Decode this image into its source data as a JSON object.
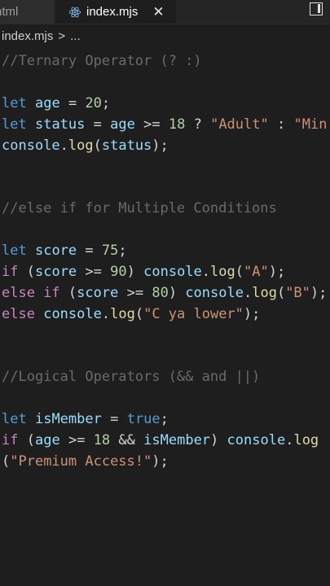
{
  "tabs": {
    "inactive_label": "html",
    "active_label": "index.mjs",
    "close_glyph": "✕"
  },
  "breadcrumb": {
    "file": "index.mjs",
    "separator": ">",
    "more": "..."
  },
  "code": {
    "c1": "//Ternary Operator (? :)",
    "l2_kw": "let",
    "l2_var": "age",
    "l2_op": "=",
    "l2_num": "20",
    "l2_end": ";",
    "l3_kw": "let",
    "l3_var": "status",
    "l3_op": "=",
    "l3_var2": "age",
    "l3_cmp": ">=",
    "l3_num": "18",
    "l3_q": "?",
    "l3_str": "\"Adult\"",
    "l3_colon": ":",
    "l3_str2": "\"Min",
    "l4_obj": "console",
    "l4_dot": ".",
    "l4_fn": "log",
    "l4_open": "(",
    "l4_arg": "status",
    "l4_close": ");",
    "c2": "//else if for Multiple Conditions",
    "l6_kw": "let",
    "l6_var": "score",
    "l6_op": "=",
    "l6_num": "75",
    "l6_end": ";",
    "l7_kw": "if",
    "l7_open": "(",
    "l7_var": "score",
    "l7_cmp": ">=",
    "l7_num": "90",
    "l7_close": ")",
    "l7_obj": "console",
    "l7_dot": ".",
    "l7_fn": "log",
    "l7_p1": "(",
    "l7_str": "\"A\"",
    "l7_p2": ");",
    "l8_kw": "else if",
    "l8_open": "(",
    "l8_var": "score",
    "l8_cmp": ">=",
    "l8_num": "80",
    "l8_close": ")",
    "l8_obj": "console",
    "l8_dot": ".",
    "l8_fn": "log",
    "l8_p1": "(",
    "l8_str": "\"B\"",
    "l8_p2": ");",
    "l9_kw": "else",
    "l9_obj": "console",
    "l9_dot": ".",
    "l9_fn": "log",
    "l9_p1": "(",
    "l9_str": "\"C ya lower\"",
    "l9_p2": ");",
    "c3": "//Logical Operators (&& and ||)",
    "l11_kw": "let",
    "l11_var": "isMember",
    "l11_op": "=",
    "l11_val": "true",
    "l11_end": ";",
    "l12_kw": "if",
    "l12_open": "(",
    "l12_var": "age",
    "l12_cmp": ">=",
    "l12_num": "18",
    "l12_and": "&&",
    "l12_var2": "isMember",
    "l12_close": ")",
    "l12_obj": "console",
    "l12_dot": ".",
    "l12_fn": "log",
    "l13_p1": "(",
    "l13_str": "\"Premium Access!\"",
    "l13_p2": ");"
  }
}
